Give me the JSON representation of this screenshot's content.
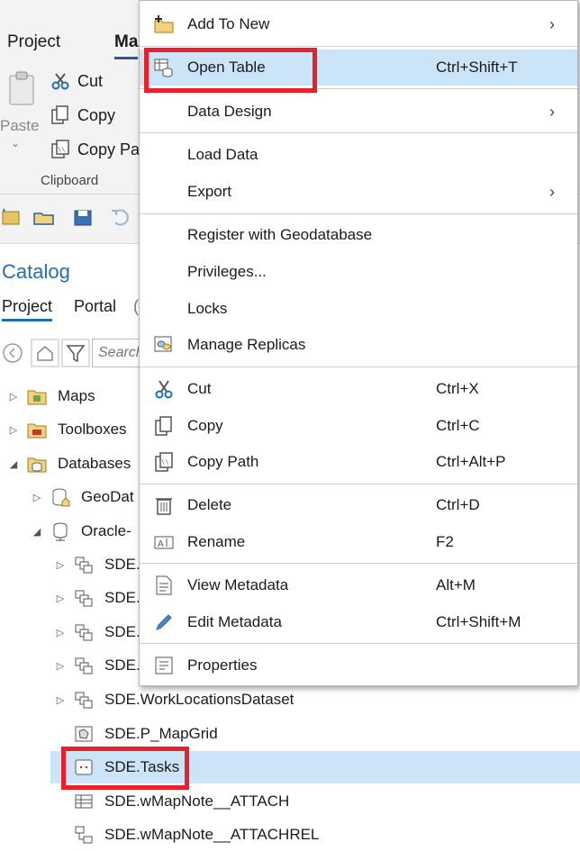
{
  "ribbon": {
    "tabs": [
      "Project",
      "Ma"
    ],
    "paste_label": "Paste",
    "clipboard": {
      "cut_label": "Cut",
      "copy_label": "Copy",
      "copy_path_label": "Copy Pa",
      "group_label": "Clipboard"
    }
  },
  "catalog": {
    "title": "Catalog",
    "tabs": [
      "Project",
      "Portal",
      "("
    ],
    "search_placeholder": "Search",
    "tree": [
      {
        "label": "Maps",
        "icon": "folder-maps-icon"
      },
      {
        "label": "Toolboxes",
        "icon": "toolbox-folder-icon"
      },
      {
        "label": "Databases",
        "icon": "database-folder-icon"
      },
      {
        "label": "GeoDat",
        "icon": "geodatabase-icon"
      },
      {
        "label": "Oracle-",
        "icon": "database-connection-icon"
      },
      {
        "label": "SDE.",
        "icon": "feature-dataset-icon"
      },
      {
        "label": "SDE.",
        "icon": "feature-dataset-icon"
      },
      {
        "label": "SDE.",
        "icon": "feature-dataset-icon"
      },
      {
        "label": "SDE.",
        "icon": "feature-dataset-icon"
      },
      {
        "label": "SDE.WorkLocationsDataset",
        "icon": "feature-dataset-icon"
      },
      {
        "label": "SDE.P_MapGrid",
        "icon": "polygon-feature-class-icon"
      },
      {
        "label": "SDE.Tasks",
        "icon": "point-feature-class-icon"
      },
      {
        "label": "SDE.wMapNote__ATTACH",
        "icon": "table-icon"
      },
      {
        "label": "SDE.wMapNote__ATTACHREL",
        "icon": "relationship-class-icon"
      }
    ]
  },
  "context_menu": {
    "items": [
      {
        "label": "Add To New",
        "shortcut": "",
        "submenu": true,
        "icon": "add-to-new-icon"
      },
      {
        "label": "Open Table",
        "shortcut": "Ctrl+Shift+T",
        "submenu": false,
        "icon": "open-table-icon"
      },
      {
        "label": "Data Design",
        "shortcut": "",
        "submenu": true,
        "icon": ""
      },
      {
        "label": "Load Data",
        "shortcut": "",
        "submenu": false,
        "icon": ""
      },
      {
        "label": "Export",
        "shortcut": "",
        "submenu": true,
        "icon": ""
      },
      {
        "label": "Register with Geodatabase",
        "shortcut": "",
        "submenu": false,
        "icon": ""
      },
      {
        "label": "Privileges...",
        "shortcut": "",
        "submenu": false,
        "icon": ""
      },
      {
        "label": "Locks",
        "shortcut": "",
        "submenu": false,
        "icon": ""
      },
      {
        "label": "Manage Replicas",
        "shortcut": "",
        "submenu": false,
        "icon": "manage-replicas-icon"
      },
      {
        "label": "Cut",
        "shortcut": "Ctrl+X",
        "submenu": false,
        "icon": "scissors-icon"
      },
      {
        "label": "Copy",
        "shortcut": "Ctrl+C",
        "submenu": false,
        "icon": "copy-icon"
      },
      {
        "label": "Copy Path",
        "shortcut": "Ctrl+Alt+P",
        "submenu": false,
        "icon": "copy-path-icon"
      },
      {
        "label": "Delete",
        "shortcut": "Ctrl+D",
        "submenu": false,
        "icon": "trash-icon"
      },
      {
        "label": "Rename",
        "shortcut": "F2",
        "submenu": false,
        "icon": "rename-icon"
      },
      {
        "label": "View Metadata",
        "shortcut": "Alt+M",
        "submenu": false,
        "icon": "view-metadata-icon"
      },
      {
        "label": "Edit Metadata",
        "shortcut": "Ctrl+Shift+M",
        "submenu": false,
        "icon": "edit-metadata-icon"
      },
      {
        "label": "Properties",
        "shortcut": "",
        "submenu": false,
        "icon": "properties-icon"
      }
    ],
    "submenu_arrow": "›"
  },
  "colors": {
    "highlight": "#cce4f7",
    "annotation_red": "#e8202a",
    "accent_blue": "#1f6fb2"
  }
}
